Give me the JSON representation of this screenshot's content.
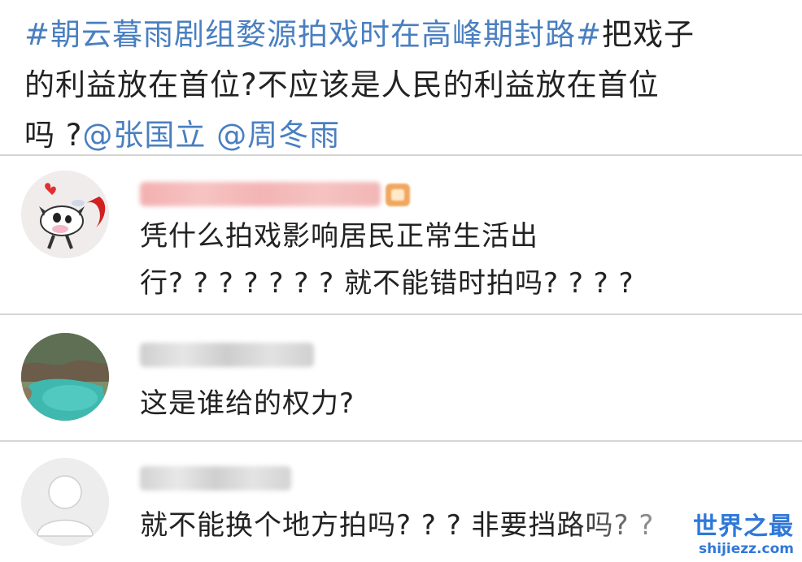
{
  "post": {
    "tag": "#朝云暮雨剧组婺源拍戏时在高峰期封路#",
    "text_line1_tail": "把戏子",
    "text_line2": "的利益放在首位?不应该是人民的利益放在首位",
    "text_line3_prefix": "吗 ?",
    "mention1": "@张国立",
    "mention2": "@周冬雨"
  },
  "comments": [
    {
      "avatar": "cartoon-cow-avatar",
      "line1": "凭什么拍戏影响居民正常生活出",
      "line2": "行? ? ? ? ? ? ?  就不能错时拍吗? ? ? ?"
    },
    {
      "avatar": "landscape-avatar",
      "line1": "这是谁给的权力?"
    },
    {
      "avatar": "default-user-avatar",
      "line1": "就不能换个地方拍吗? ? ?  非要挡路吗? ?"
    }
  ],
  "watermark": {
    "title": "世界之最",
    "site": "shijiezz.com"
  },
  "colors": {
    "link": "#4a7fc0",
    "watermark": "#2f78d8",
    "divider": "#d5d5d5"
  }
}
